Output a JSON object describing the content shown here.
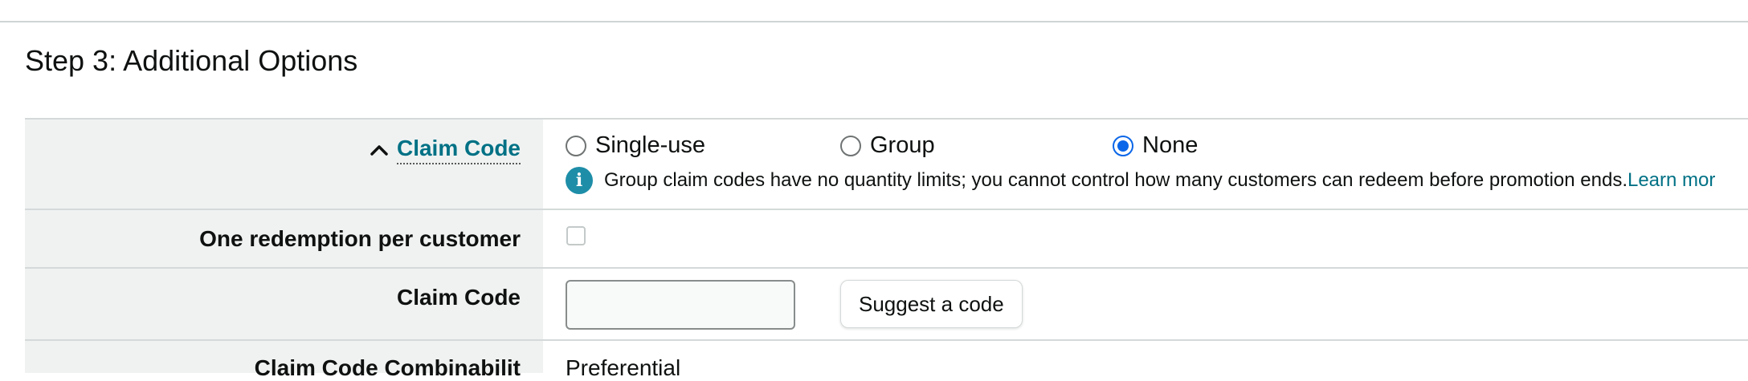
{
  "step_title": "Step 3: Additional Options",
  "rows": {
    "claim_code_toggle": {
      "label": "Claim Code",
      "options": [
        "Single-use",
        "Group",
        "None"
      ],
      "selected": "None",
      "info_text": "Group claim codes have no quantity limits; you cannot control how many customers can redeem before promotion ends.",
      "learn_more": "Learn mor"
    },
    "one_redemption": {
      "label": "One redemption per customer",
      "checked": false
    },
    "claim_code": {
      "label": "Claim Code",
      "value": "",
      "suggest_label": "Suggest a code"
    },
    "combinability": {
      "label": "Claim Code Combinabilit",
      "value": "Preferential"
    }
  },
  "colors": {
    "link": "#007185",
    "label_bg": "#f0f2f2",
    "radio_selected": "#0a66e8",
    "info_icon": "#1e8ea8"
  },
  "icons": {
    "toggle": "chevron-up-icon",
    "info": "info-icon"
  }
}
